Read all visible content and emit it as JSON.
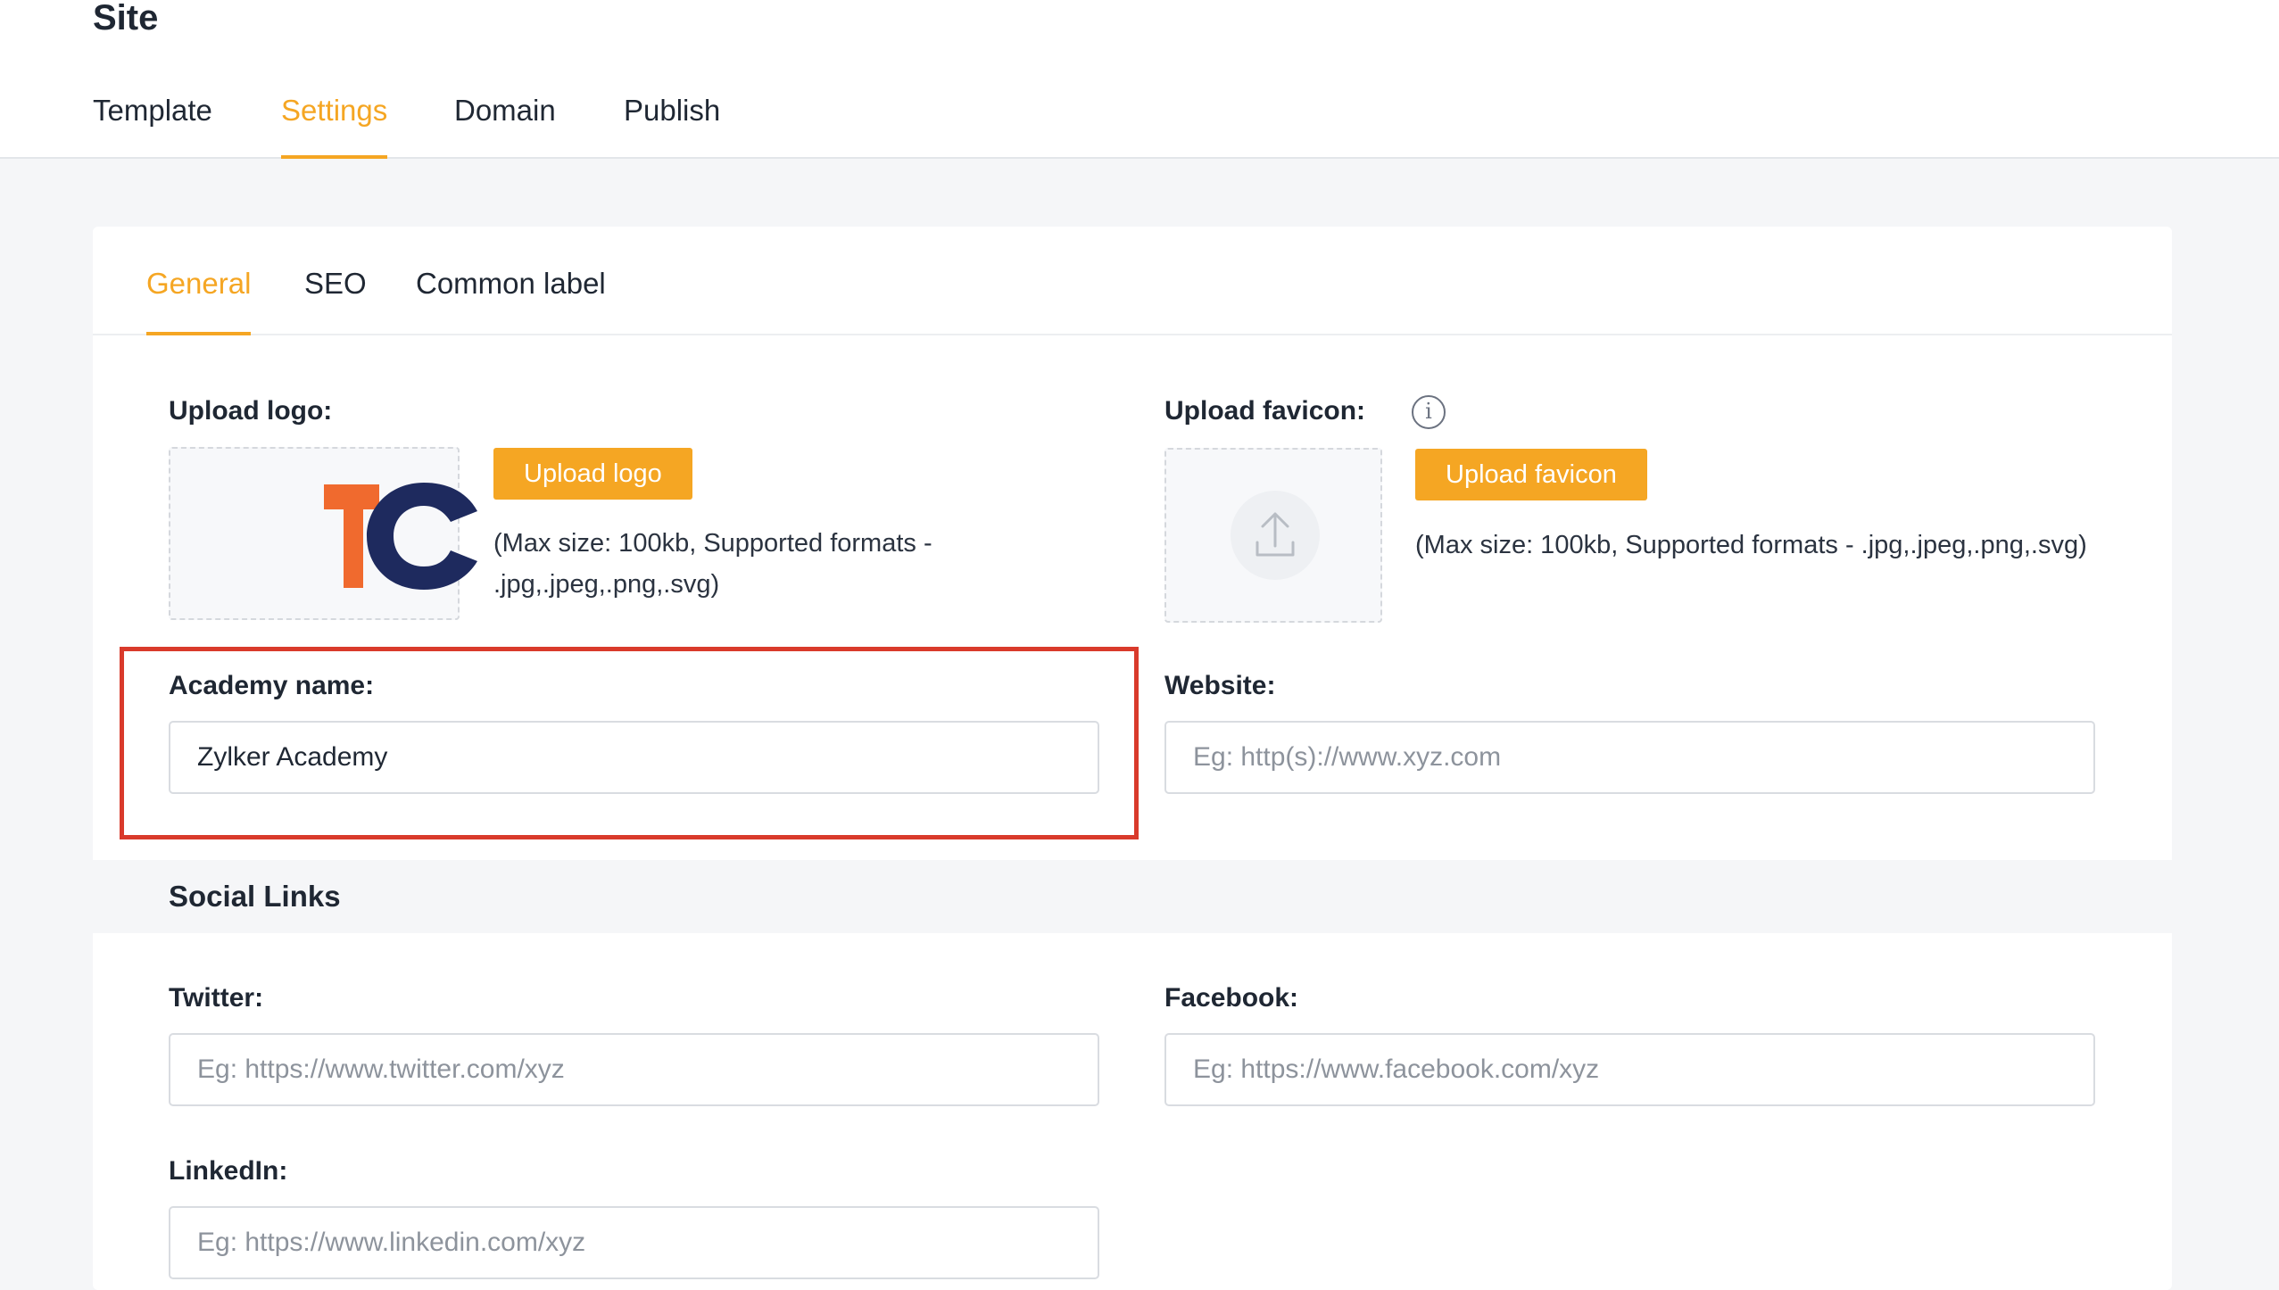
{
  "header": {
    "title": "Site",
    "tabs": [
      {
        "label": "Template"
      },
      {
        "label": "Settings"
      },
      {
        "label": "Domain"
      },
      {
        "label": "Publish"
      }
    ],
    "active_tab": "Settings"
  },
  "settings": {
    "sub_tabs": [
      {
        "label": "General"
      },
      {
        "label": "SEO"
      },
      {
        "label": "Common label"
      }
    ],
    "active_sub_tab": "General",
    "logo": {
      "label": "Upload logo:",
      "button": "Upload logo",
      "hint_line1": "(Max size: 100kb, Supported formats -",
      "hint_line2": ".jpg,.jpeg,.png,.svg)"
    },
    "favicon": {
      "label": "Upload favicon:",
      "button": "Upload favicon",
      "hint": "(Max size: 100kb, Supported formats - .jpg,.jpeg,.png,.svg)",
      "info_icon": "info-icon"
    },
    "academy_name": {
      "label": "Academy name:",
      "value": "Zylker Academy"
    },
    "website": {
      "label": "Website:",
      "placeholder": "Eg: http(s)://www.xyz.com"
    },
    "social": {
      "title": "Social Links",
      "twitter": {
        "label": "Twitter:",
        "placeholder": "Eg: https://www.twitter.com/xyz"
      },
      "facebook": {
        "label": "Facebook:",
        "placeholder": "Eg: https://www.facebook.com/xyz"
      },
      "linkedin": {
        "label": "LinkedIn:",
        "placeholder": "Eg: https://www.linkedin.com/xyz"
      }
    }
  },
  "colors": {
    "accent": "#f5a623",
    "highlight": "#d93a2b",
    "logo_orange": "#f06a2e",
    "logo_navy": "#1e2a5e"
  }
}
